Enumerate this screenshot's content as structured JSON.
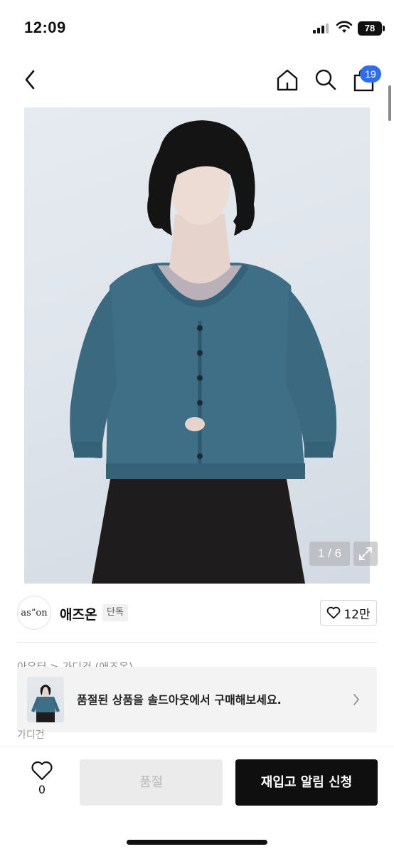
{
  "status_bar": {
    "time": "12:09",
    "battery": "78"
  },
  "nav": {
    "cart_count": "19"
  },
  "gallery": {
    "indicator": "1 / 6"
  },
  "brand": {
    "logo_text": "as”on",
    "name": "애즈온",
    "tag": "단독",
    "likes": "12만"
  },
  "breadcrumb": {
    "text": "아우터 > 가디건 (애즈온)"
  },
  "banner": {
    "message": "품절된 상품을 솔드아웃에서 구매해보세요.",
    "under_text": "가디건"
  },
  "bottom": {
    "wish_count": "0",
    "soldout_label": "품절",
    "restock_label": "재입고 알림 신청"
  },
  "icons": [
    "back-icon",
    "home-icon",
    "search-icon",
    "shopping-bag-icon",
    "expand-icon",
    "heart-icon",
    "chevron-right-icon"
  ],
  "colors": {
    "badge": "#2f6ee8",
    "cardigan": "#3f6f86",
    "primary_button": "#0f0f0f",
    "disabled_button": "#ebebeb"
  }
}
